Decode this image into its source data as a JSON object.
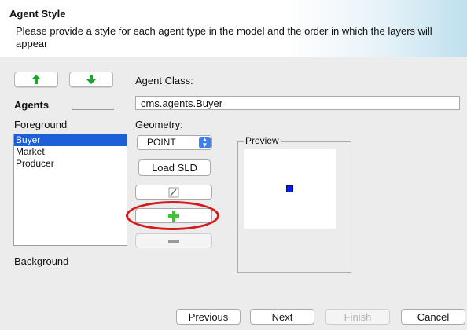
{
  "header": {
    "title": "Agent Style",
    "description": "Please provide a style for each agent type in the model and the order in which the layers will appear"
  },
  "labels": {
    "agent_class": "Agent Class:",
    "agents": "Agents",
    "foreground": "Foreground",
    "background": "Background",
    "geometry": "Geometry:",
    "preview": "Preview"
  },
  "agent_class_value": "cms.agents.Buyer",
  "agents_list": [
    "Buyer",
    "Market",
    "Producer"
  ],
  "selected_agent": "Buyer",
  "geometry": {
    "selected": "POINT"
  },
  "buttons": {
    "load_sld": "Load SLD",
    "previous": "Previous",
    "next": "Next",
    "finish": "Finish",
    "cancel": "Cancel"
  },
  "icons": {
    "move_up": "up-arrow-icon",
    "move_down": "down-arrow-icon",
    "edit": "edit-rule-icon",
    "add": "plus-icon",
    "remove": "minus-icon"
  },
  "colors": {
    "selection": "#1c5fd8",
    "arrow_green": "#17a52c",
    "plus_green": "#3cc233",
    "highlight_red": "#d21b1b",
    "preview_marker": "#0a1bf0"
  }
}
